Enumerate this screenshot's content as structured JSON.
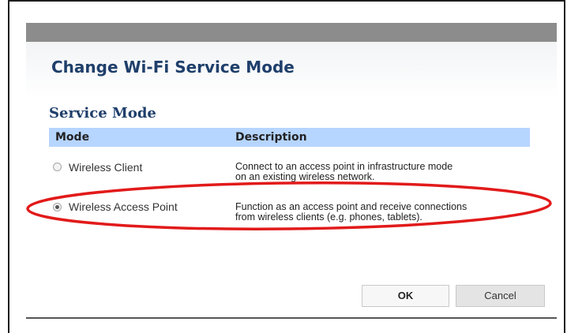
{
  "dialog": {
    "title": "Change Wi-Fi Service Mode",
    "section_title": "Service Mode",
    "columns": {
      "mode": "Mode",
      "description": "Description"
    },
    "options": [
      {
        "label": "Wireless Client",
        "selected": false,
        "description_line1": "Connect to an access point in infrastructure mode",
        "description_line2": "on an existing wireless network."
      },
      {
        "label": "Wireless Access Point",
        "selected": true,
        "description_line1": "Function as an access point and receive connections",
        "description_line2": "from wireless clients (e.g. phones, tablets)."
      }
    ],
    "buttons": {
      "ok": "OK",
      "cancel": "Cancel"
    }
  },
  "colors": {
    "title_text": "#1f3f6b",
    "table_header_bg": "#b6d5ff",
    "titlebar_bg": "#8c8c8c",
    "annotation_ellipse": "#e21a1a"
  }
}
